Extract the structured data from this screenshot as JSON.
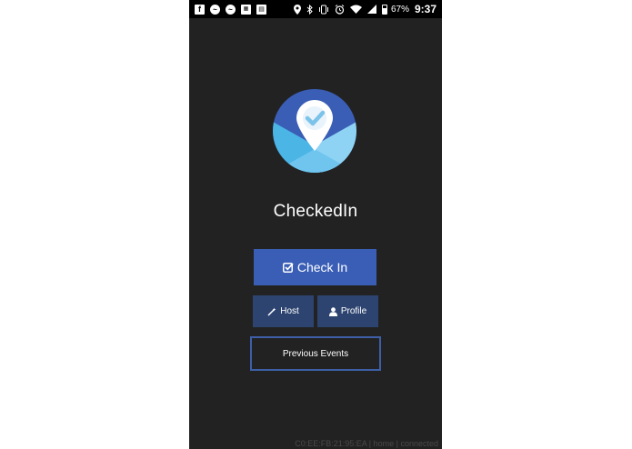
{
  "status_bar": {
    "left_icons": [
      "facebook-icon",
      "messenger-icon",
      "messenger-icon",
      "app-icon",
      "news-icon"
    ],
    "right_icons": [
      "location-icon",
      "bluetooth-icon",
      "vibrate-icon",
      "alarm-icon",
      "wifi-icon",
      "signal-icon",
      "battery-icon"
    ],
    "battery_percent": "67%",
    "time": "9:37"
  },
  "app": {
    "name": "CheckedIn",
    "logo_colors": {
      "circle": "#3a5eb6",
      "light_blue": "#8fd3f4",
      "mid_blue": "#4bb5e6",
      "pin": "#ffffff",
      "check": "#7cc3ea"
    }
  },
  "buttons": {
    "checkin": {
      "label": "Check In",
      "icon": "checkbox-icon"
    },
    "host": {
      "label": "Host",
      "icon": "magic-wand-icon"
    },
    "profile": {
      "label": "Profile",
      "icon": "user-icon"
    },
    "previous": {
      "label": "Previous Events"
    }
  },
  "footer": {
    "text": "C0:EE:FB:21:95:EA | home | connected"
  },
  "colors": {
    "background": "#222222",
    "primary": "#3a5eb6",
    "secondary": "#2d4470",
    "outline": "#3e5fa8"
  }
}
